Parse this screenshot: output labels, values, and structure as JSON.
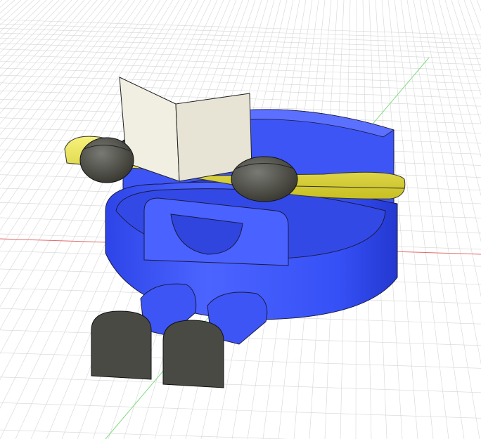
{
  "viewport": {
    "background": "#ffffff",
    "grid_color": "#d6d6d6",
    "x_axis_color": "#e06a6a",
    "y_axis_color": "#7fdc7f"
  },
  "model": {
    "body_color": "#3d55f5",
    "body_shadow": "#2536c8",
    "arm_color": "#e8e24a",
    "hand_color": "#4d4d48",
    "book_color": "#f1eee2"
  }
}
